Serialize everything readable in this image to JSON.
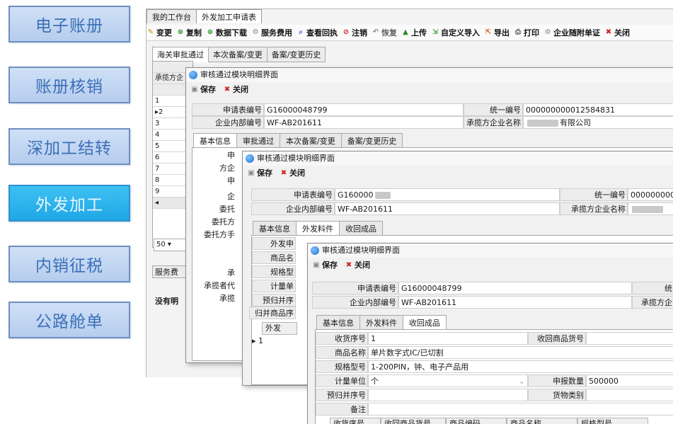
{
  "nav": {
    "items": [
      {
        "label": "电子账册",
        "active": false
      },
      {
        "label": "账册核销",
        "active": false
      },
      {
        "label": "深加工结转",
        "active": false
      },
      {
        "label": "外发加工",
        "active": true
      },
      {
        "label": "内销征税",
        "active": false
      },
      {
        "label": "公路舱单",
        "active": false
      }
    ]
  },
  "main": {
    "tabs": [
      "我的工作台",
      "外发加工申请表"
    ],
    "toolbar": [
      "变更",
      "复制",
      "数据下载",
      "服务费用",
      "查看回执",
      "注销",
      "恢复",
      "上传",
      "自定义导入",
      "导出",
      "打印",
      "企业随附单证",
      "关闭"
    ],
    "subtabs": [
      "海关审批通过",
      "本次备案/变更",
      "备案/变更历史"
    ],
    "grid_rows": [
      "1",
      "2",
      "3",
      "4",
      "5",
      "6",
      "7",
      "8",
      "9"
    ],
    "pager": "50",
    "service_label": "服务费",
    "no_data": "没有明",
    "left_labels": [
      "承揽方企",
      "申",
      "委托方",
      "委托方手",
      "承",
      "承揽者代码",
      "承揽"
    ]
  },
  "dialog1": {
    "title": "审核通过模块明细界面",
    "save": "保存",
    "close": "关闭",
    "apply_no_label": "申请表编号",
    "apply_no": "G16000048799",
    "unified_label": "统一编号",
    "unified_no": "000000000012584831",
    "inner_no_label": "企业内部编号",
    "inner_no": "WF-AB201611",
    "contractor_label": "承揽方企业名称",
    "contractor_suffix": "有限公司",
    "tabs": [
      "基本信息",
      "审批通过",
      "本次备案/变更",
      "备案/变更历史"
    ],
    "side_labels": [
      "申",
      "方企",
      "申",
      "企",
      "委托",
      "委托方",
      "委托方手",
      "承",
      "承揽者代",
      "承揽"
    ]
  },
  "dialog2": {
    "title": "审核通过模块明细界面",
    "save": "保存",
    "close": "关闭",
    "apply_no_label": "申请表编号",
    "apply_no": "G160000",
    "unified_label": "统一编号",
    "unified_no": "000000000",
    "inner_no_label": "企业内部编号",
    "inner_no": "WF-AB201611",
    "contractor_label": "承揽方企业名称",
    "tabs": [
      "基本信息",
      "外发料件",
      "收回成品"
    ],
    "field_labels": [
      "外发申",
      "商品名",
      "规格型",
      "计量单",
      "预归并序",
      "归并商品序"
    ],
    "grid_header": "外发",
    "row_one": "1"
  },
  "dialog3": {
    "title": "审核通过模块明细界面",
    "save": "保存",
    "close": "关闭",
    "apply_no_label": "申请表编号",
    "apply_no": "G16000048799",
    "unified_label": "统",
    "inner_no_label": "企业内部编号",
    "inner_no": "WF-AB201611",
    "contractor_label": "承揽方企",
    "tabs": [
      "基本信息",
      "外发料件",
      "收回成品"
    ],
    "seq_label": "收货序号",
    "seq": "1",
    "item_no_label": "收回商品货号",
    "goods_label": "商品名称",
    "goods": "单片数字式IC/已切割",
    "spec_label": "规格型号",
    "spec": "1-200PIN，钟、电子产品用",
    "unit_label": "计量单位",
    "unit": "个",
    "qty_label": "申报数量",
    "qty": "500000",
    "pre_label": "预归并序号",
    "category_label": "货物类别",
    "remark_label": "备注",
    "grid_headers": [
      "收货序号",
      "收回商品货号",
      "商品编码",
      "商品名称",
      "规格型号"
    ]
  }
}
